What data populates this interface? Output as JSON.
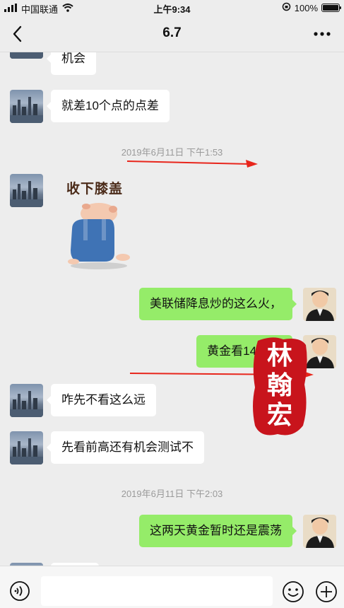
{
  "status_bar": {
    "carrier": "中国联通",
    "time": "上午9:34",
    "battery": "100%",
    "battery_level": 1.0
  },
  "header": {
    "title": "6.7",
    "back_icon": "chevron-left-icon",
    "more_icon": "more-dots-icon"
  },
  "messages": [
    {
      "side": "left",
      "text": "机会"
    },
    {
      "side": "left",
      "text": "就差10个点的点差"
    },
    {
      "type": "time",
      "text": "2019年6月11日 下午1:53"
    },
    {
      "side": "left",
      "type": "sticker",
      "text": "收下膝盖"
    },
    {
      "side": "right",
      "text": "美联储降息炒的这么火，"
    },
    {
      "side": "right",
      "text": "黄金看1400了"
    },
    {
      "side": "left",
      "text": "咋先不看这么远"
    },
    {
      "side": "left",
      "text": "先看前高还有机会测试不"
    },
    {
      "type": "time",
      "text": "2019年6月11日 下午2:03"
    },
    {
      "side": "right",
      "text": "这两天黄金暂时还是震荡"
    }
  ],
  "stamp": {
    "text_1": "林",
    "text_2": "翰",
    "text_3": "宏"
  },
  "input_bar": {
    "input_value": "",
    "voice_icon": "voice-icon",
    "emoji_icon": "emoji-icon",
    "plus_icon": "plus-icon"
  },
  "colors": {
    "background": "#ededed",
    "bubble_right": "#95ec69",
    "bubble_left": "#ffffff",
    "arrow": "#e8261c",
    "stamp": "#c8141c"
  }
}
